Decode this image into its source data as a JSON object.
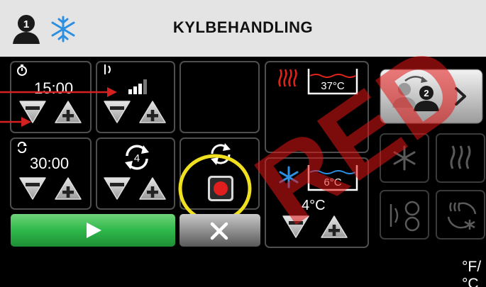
{
  "header": {
    "title": "KYLBEHANDLING"
  },
  "timer1": {
    "time": "15:00"
  },
  "timer2": {
    "time": "30:00"
  },
  "cycle": {
    "count": "4"
  },
  "hot_tank": {
    "temp": "37°C"
  },
  "cold_tank": {
    "temp": "6°C",
    "setpoint": "4°C"
  },
  "units": {
    "label": "°F/°C"
  },
  "watermark": {
    "text": "RED"
  },
  "colors": {
    "header_bg": "#e4e4e4",
    "start_green": "#2fb84a",
    "record_red": "#e01e1e",
    "hot_red": "#e2231a",
    "cold_blue": "#2d8fe0",
    "ring_yellow": "#f0e020",
    "arrow_red": "#d52020"
  }
}
